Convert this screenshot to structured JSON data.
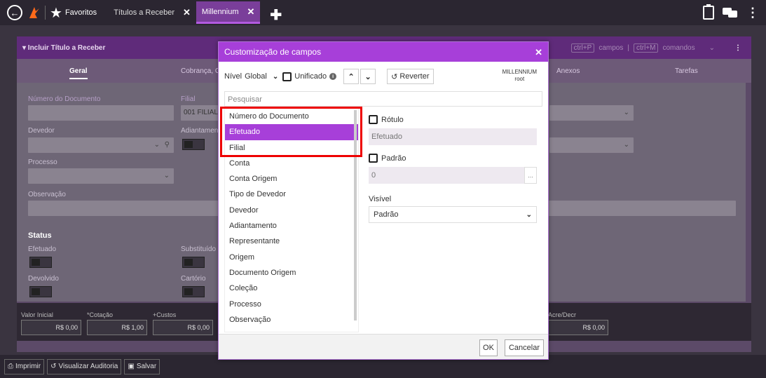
{
  "topbar": {
    "favorites_label": "Favoritos",
    "tabs": [
      {
        "label": "Títulos a Receber"
      },
      {
        "label": "Millennium"
      }
    ],
    "close_glyph": "✕",
    "add_glyph": "✚"
  },
  "app": {
    "panel_title": "▾ Incluir Título a Receber",
    "shortcuts": {
      "campos_key": "ctrl+P",
      "campos_label": "campos",
      "comandos_key": "ctrl+M",
      "comandos_label": "comandos"
    },
    "tabs": [
      "Geral",
      "Cobrança, C",
      "Anexos",
      "Tarefas"
    ],
    "fields": {
      "numero_documento": "Número do Documento",
      "filial": "Filial",
      "filial_value": "001 FILIAL",
      "devedor": "Devedor",
      "adiantamento": "Adiantamen",
      "processo": "Processo",
      "observacao": "Observação",
      "status": "Status",
      "efetuado": "Efetuado",
      "substituido": "Substituído",
      "devolvido": "Devolvido",
      "cartorio": "Cartório"
    },
    "money": {
      "valor_inicial_label": "Valor Inicial",
      "valor_inicial": "R$ 0,00",
      "cotacao_label": "*Cotação",
      "cotacao": "R$ 1,00",
      "custos_label": "+Custos",
      "custos": "R$ 0,00",
      "acre_label": "Acre/Decr",
      "acre": "R$ 0,00"
    },
    "bottom_buttons": [
      "Imprimir",
      "Visualizar Auditoria",
      "Salvar"
    ]
  },
  "modal": {
    "title": "Customização de campos",
    "nivel_label": "Nível",
    "nivel_value": "Global",
    "unificado_label": "Unificado",
    "reverter_label": "Reverter",
    "context_line1": "MILLENNIUM",
    "context_line2": "root",
    "search_placeholder": "Pesquisar",
    "fields": [
      "Número do Documento",
      "Efetuado",
      "Filial",
      "Conta",
      "Conta Origem",
      "Tipo de Devedor",
      "Devedor",
      "Adiantamento",
      "Representante",
      "Origem",
      "Documento Origem",
      "Coleção",
      "Processo",
      "Observação"
    ],
    "selected_field": "Efetuado",
    "rotulo_label": "Rótulo",
    "rotulo_value": "Efetuado",
    "padrao_label": "Padrão",
    "padrao_value": "0",
    "dots": "...",
    "visivel_label": "Visível",
    "visivel_value": "Padrão",
    "ok_label": "OK",
    "cancel_label": "Cancelar"
  },
  "colors": {
    "accent": "#a73fd9",
    "highlight": "#e00000"
  }
}
